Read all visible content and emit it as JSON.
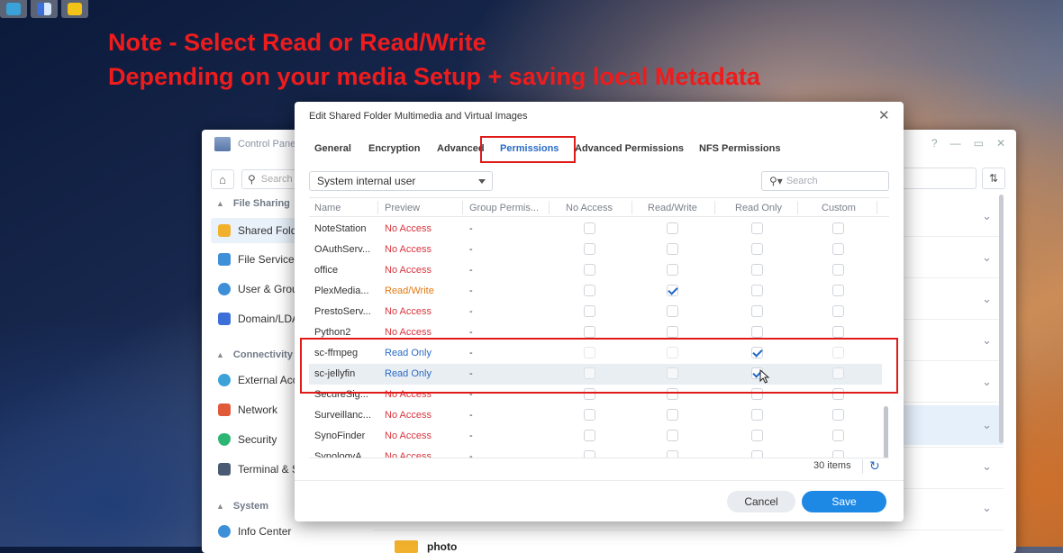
{
  "note": {
    "line1": "Note - Select Read or Read/Write",
    "line2": "Depending on your media Setup + saving local Metadata"
  },
  "control_panel": {
    "title": "Control Panel",
    "search_placeholder": "Search",
    "sections": [
      {
        "label": "File Sharing"
      },
      {
        "label": "Connectivity"
      },
      {
        "label": "System"
      }
    ],
    "items": [
      {
        "label": "Shared Folder",
        "icon": "folder-icon",
        "color": "#f1b12c",
        "active": true
      },
      {
        "label": "File Services",
        "icon": "file-services-icon",
        "color": "#3d8fd8"
      },
      {
        "label": "User & Group",
        "icon": "user-group-icon",
        "color": "#3d8fd8"
      },
      {
        "label": "Domain/LDAP",
        "icon": "domain-icon",
        "color": "#3d6fd8"
      },
      {
        "label": "External Access",
        "icon": "external-access-icon",
        "color": "#3da2d8"
      },
      {
        "label": "Network",
        "icon": "network-icon",
        "color": "#e05a3a"
      },
      {
        "label": "Security",
        "icon": "shield-icon",
        "color": "#2bb673"
      },
      {
        "label": "Terminal & SNMP",
        "icon": "terminal-icon",
        "color": "#4a5a72"
      },
      {
        "label": "Info Center",
        "icon": "info-icon",
        "color": "#3d8fd8"
      }
    ],
    "folder_row_label": "photo"
  },
  "dialog": {
    "title": "Edit Shared Folder Multimedia and Virtual Images",
    "tabs": [
      "General",
      "Encryption",
      "Advanced",
      "Permissions",
      "Advanced Permissions",
      "NFS Permissions"
    ],
    "active_tab": "Permissions",
    "user_type_select": "System internal user",
    "search_placeholder": "Search",
    "columns": [
      "Name",
      "Preview",
      "Group Permis...",
      "No Access",
      "Read/Write",
      "Read Only",
      "Custom"
    ],
    "rows": [
      {
        "name": "NoteStation",
        "preview": "No Access",
        "group": "-",
        "rw": false,
        "ro": false
      },
      {
        "name": "OAuthServ...",
        "preview": "No Access",
        "group": "-",
        "rw": false,
        "ro": false
      },
      {
        "name": "office",
        "preview": "No Access",
        "group": "-",
        "rw": false,
        "ro": false
      },
      {
        "name": "PlexMedia...",
        "preview": "Read/Write",
        "group": "-",
        "rw": true,
        "ro": false
      },
      {
        "name": "PrestoServ...",
        "preview": "No Access",
        "group": "-",
        "rw": false,
        "ro": false
      },
      {
        "name": "Python2",
        "preview": "No Access",
        "group": "-",
        "rw": false,
        "ro": false
      },
      {
        "name": "sc-ffmpeg",
        "preview": "Read Only",
        "group": "-",
        "rw": false,
        "ro": true
      },
      {
        "name": "sc-jellyfin",
        "preview": "Read Only",
        "group": "-",
        "rw": false,
        "ro": true
      },
      {
        "name": "SecureSig...",
        "preview": "No Access",
        "group": "-",
        "rw": false,
        "ro": false
      },
      {
        "name": "Surveillanc...",
        "preview": "No Access",
        "group": "-",
        "rw": false,
        "ro": false
      },
      {
        "name": "SynoFinder",
        "preview": "No Access",
        "group": "-",
        "rw": false,
        "ro": false
      },
      {
        "name": "SynologyA...",
        "preview": "No Access",
        "group": "-",
        "rw": false,
        "ro": false
      }
    ],
    "items_count": "30 items",
    "cancel_label": "Cancel",
    "save_label": "Save"
  },
  "colors": {
    "accent": "#1e88e5",
    "no_access": "#d8353e",
    "read_write": "#e07a13",
    "read_only": "#2a6bc4",
    "annotation_red": "#ee1c1c"
  }
}
